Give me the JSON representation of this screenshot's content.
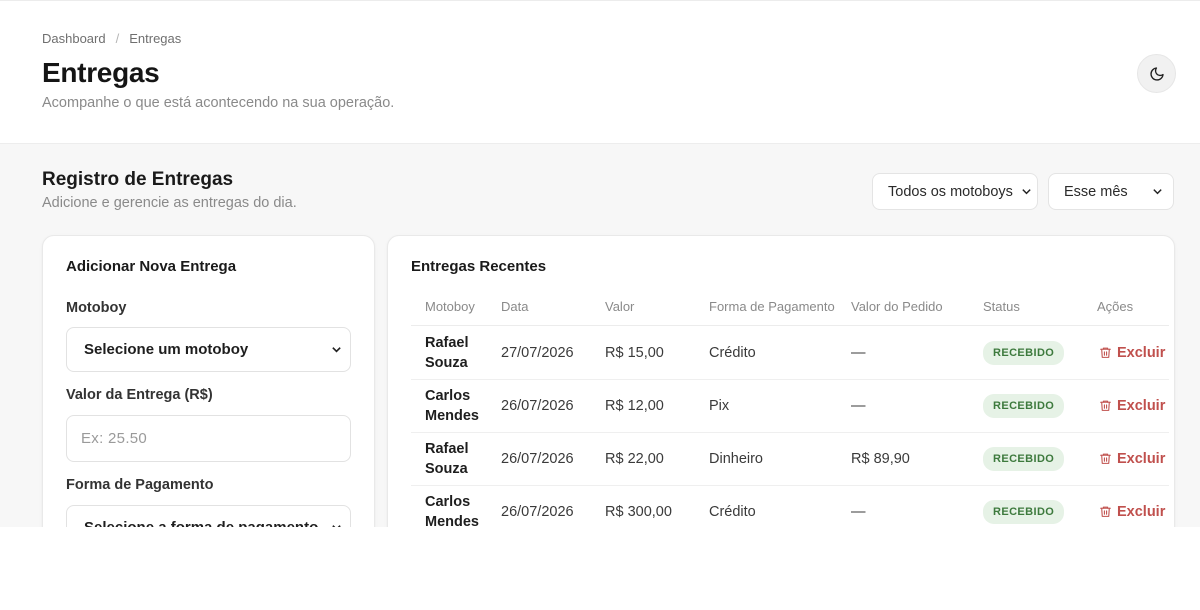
{
  "breadcrumb": {
    "items": [
      "Dashboard",
      "Entregas"
    ],
    "separator": "/"
  },
  "header": {
    "title": "Entregas",
    "subtitle": "Acompanhe o que está acontecendo na sua operação."
  },
  "section": {
    "title": "Registro de Entregas",
    "subtitle": "Adicione e gerencie as entregas do dia."
  },
  "filters": {
    "motoboy": "Todos os motoboys",
    "period": "Esse mês"
  },
  "form": {
    "title": "Adicionar Nova Entrega",
    "motoboy_label": "Motoboy",
    "motoboy_value": "Selecione um motoboy",
    "valor_label": "Valor da Entrega (R$)",
    "valor_placeholder": "Ex: 25.50",
    "pagamento_label": "Forma de Pagamento",
    "pagamento_value": "Selecione a forma de pagamento"
  },
  "table": {
    "title": "Entregas Recentes",
    "columns": [
      "Motoboy",
      "Data",
      "Valor",
      "Forma de Pagamento",
      "Valor do Pedido",
      "Status",
      "Ações"
    ],
    "rows": [
      {
        "motoboy": "Rafael Souza",
        "data": "27/07/2026",
        "valor": "R$ 15,00",
        "forma": "Crédito",
        "pedido": "—",
        "status": "RECEBIDO",
        "acao": "Excluir"
      },
      {
        "motoboy": "Carlos Mendes",
        "data": "26/07/2026",
        "valor": "R$ 12,00",
        "forma": "Pix",
        "pedido": "—",
        "status": "RECEBIDO",
        "acao": "Excluir"
      },
      {
        "motoboy": "Rafael Souza",
        "data": "26/07/2026",
        "valor": "R$ 22,00",
        "forma": "Dinheiro",
        "pedido": "R$ 89,90",
        "status": "RECEBIDO",
        "acao": "Excluir"
      },
      {
        "motoboy": "Carlos Mendes",
        "data": "26/07/2026",
        "valor": "R$ 300,00",
        "forma": "Crédito",
        "pedido": "—",
        "status": "RECEBIDO",
        "acao": "Excluir"
      }
    ]
  },
  "icons": {
    "theme": "moon-icon",
    "select": "chevron-down-icon",
    "delete": "trash-icon"
  },
  "colors": {
    "accent_danger": "#c0504d",
    "status_bg": "#e6f2e6",
    "status_text": "#3d7a3d",
    "background": "#f7f7f7"
  }
}
